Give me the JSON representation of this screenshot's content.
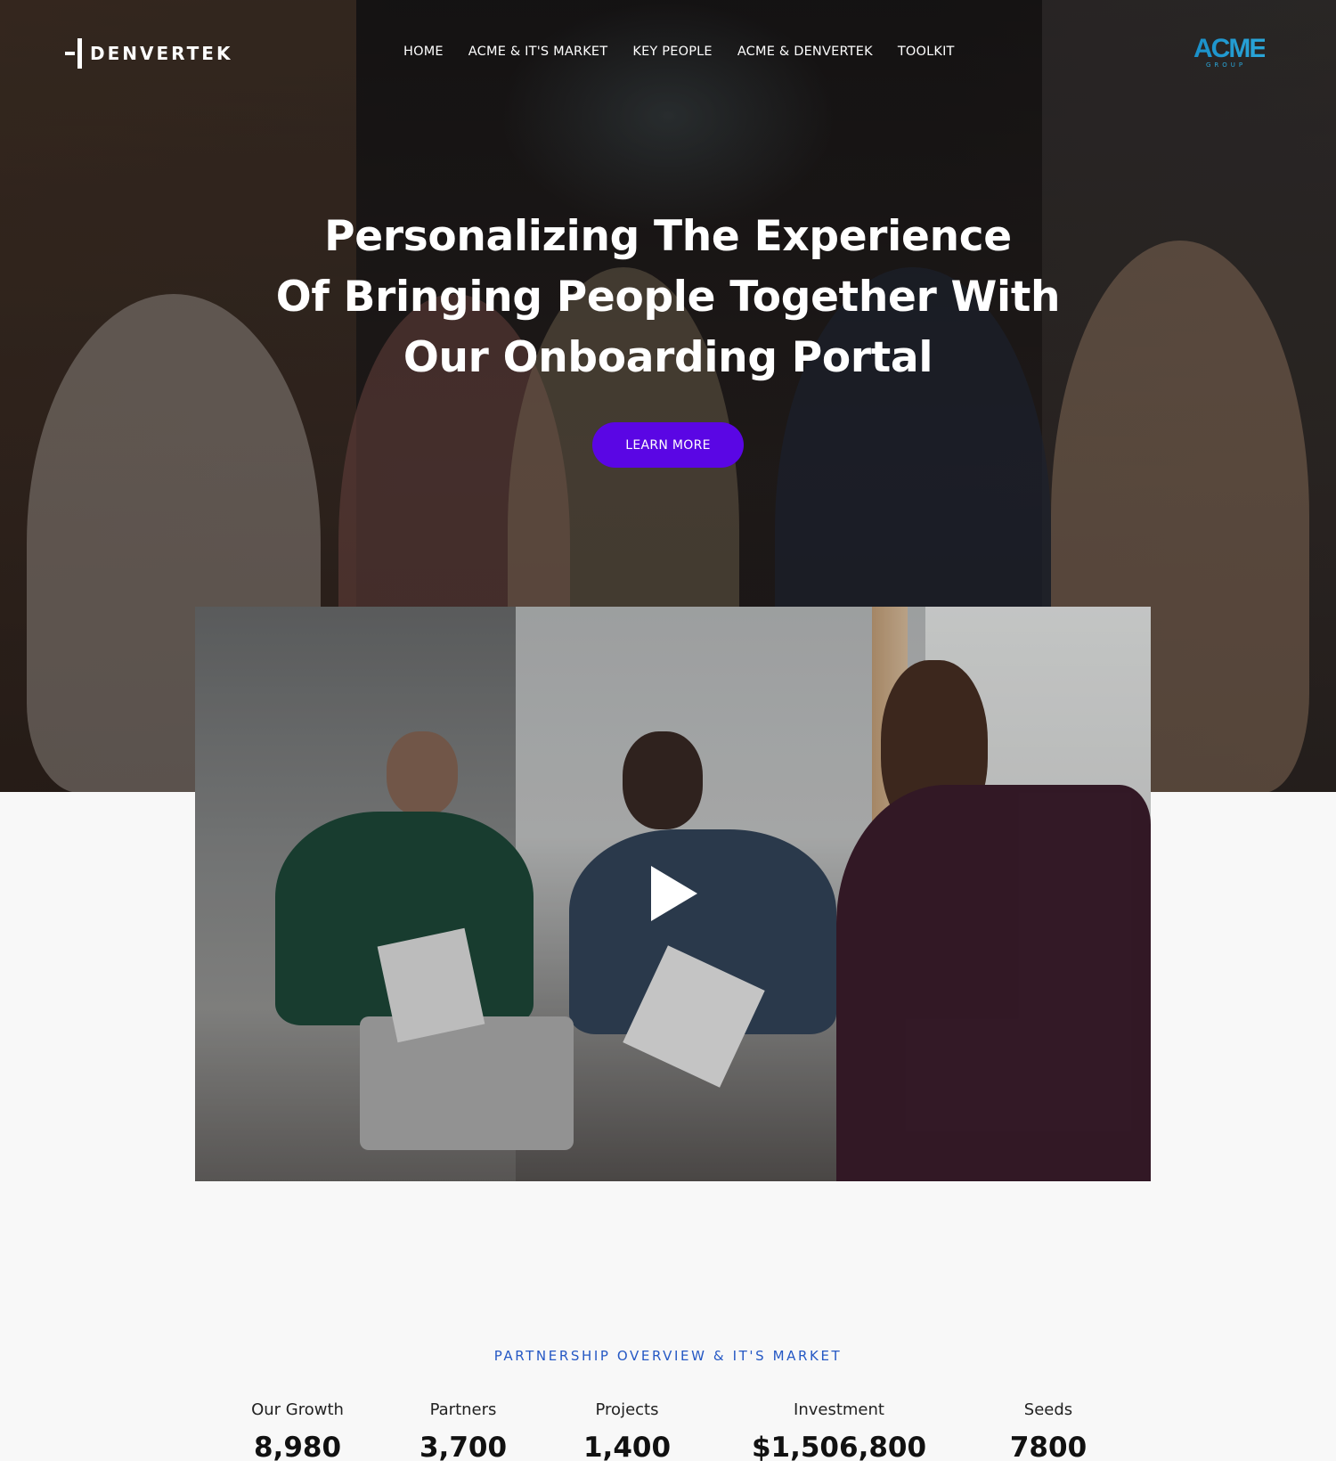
{
  "header": {
    "logo_text": "DENVERTEK",
    "partner_logo": {
      "word": "ACME",
      "sub": "GROUP"
    },
    "nav": [
      "HOME",
      "ACME & IT'S MARKET",
      "KEY PEOPLE",
      "ACME & DENVERTEK",
      "TOOLKIT"
    ]
  },
  "hero": {
    "title_lines": [
      "Personalizing The Experience",
      "Of Bringing People Together With",
      "Our Onboarding Portal"
    ],
    "cta_label": "LEARN MORE"
  },
  "video": {
    "icon": "play-icon"
  },
  "overview": {
    "label": "PARTNERSHIP OVERVIEW & IT'S MARKET",
    "stats": [
      {
        "label": "Our Growth",
        "value": "8,980"
      },
      {
        "label": "Partners",
        "value": "3,700"
      },
      {
        "label": "Projects",
        "value": "1,400"
      },
      {
        "label": "Investment",
        "value": "$1,506,800"
      },
      {
        "label": "Seeds",
        "value": "7800"
      }
    ]
  },
  "colors": {
    "accent": "#5a06e4",
    "label_blue": "#2558c4",
    "acme_blue": "#1a8fc8",
    "page_bg": "#f8f8f8"
  }
}
